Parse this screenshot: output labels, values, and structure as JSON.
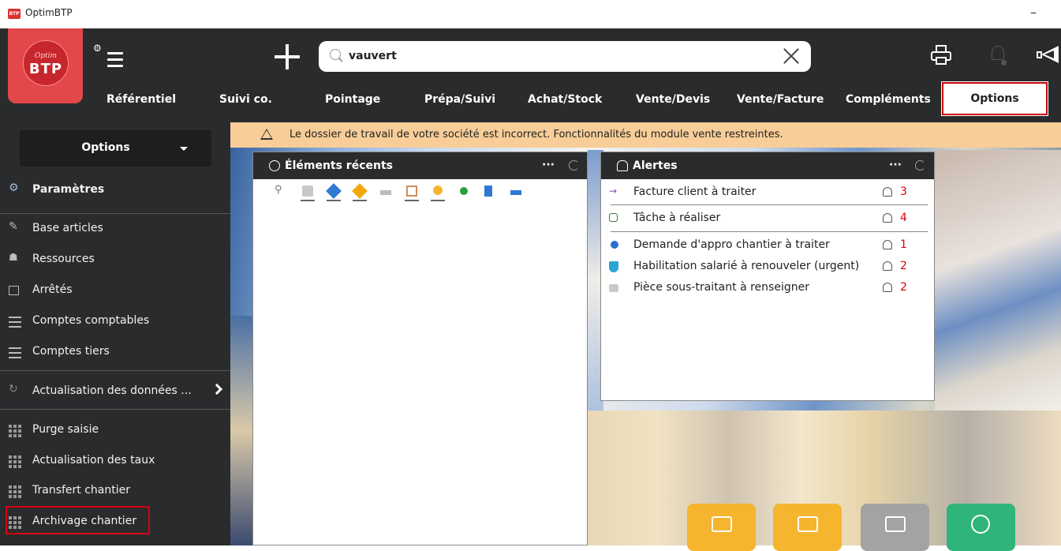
{
  "window": {
    "title": "OptimBTP",
    "minimize": "–"
  },
  "logo": {
    "top": "Optim",
    "bottom": "BTP"
  },
  "search": {
    "value": "vauvert",
    "placeholder": ""
  },
  "nav": {
    "items": [
      "Référentiel",
      "Suivi co.",
      "Pointage",
      "Prépa/Suivi",
      "Achat/Stock",
      "Vente/Devis",
      "Vente/Facture",
      "Compléments",
      "Options"
    ],
    "active": "Options"
  },
  "sidebar": {
    "dropdown": "Options",
    "items": [
      {
        "label": "Paramètres",
        "icon": "gears-icon"
      },
      {
        "label": "Base articles",
        "icon": "pencil-icon"
      },
      {
        "label": "Ressources",
        "icon": "users-icon"
      },
      {
        "label": "Arrêtés",
        "icon": "calendar-icon"
      },
      {
        "label": "Comptes comptables",
        "icon": "list-icon"
      },
      {
        "label": "Comptes tiers",
        "icon": "list-icon"
      },
      {
        "label": "Actualisation des données ...",
        "icon": "refresh-icon"
      },
      {
        "label": "Purge saisie",
        "icon": "grid-icon"
      },
      {
        "label": "Actualisation des taux",
        "icon": "grid-icon"
      },
      {
        "label": "Transfert chantier",
        "icon": "grid-icon"
      },
      {
        "label": "Archivage chantier",
        "icon": "grid-icon"
      }
    ]
  },
  "warning": {
    "text": "Le dossier de travail de votre société est incorrect. Fonctionnalités du module vente restreintes."
  },
  "recent": {
    "title": "Éléments récents",
    "more": "···"
  },
  "alerts": {
    "title": "Alertes",
    "more": "···",
    "rows": [
      {
        "text": "Facture client à traiter",
        "count": "3",
        "icon": "arrow-right-icon"
      },
      {
        "text": "Tâche à réaliser",
        "count": "4",
        "icon": "task-icon"
      },
      {
        "text": "Demande d'appro chantier à traiter",
        "count": "1",
        "icon": "blue-dot-icon"
      },
      {
        "text": "Habilitation salarié à renouveler (urgent)",
        "count": "2",
        "icon": "shield-icon"
      },
      {
        "text": "Pièce sous-traitant à renseigner",
        "count": "2",
        "icon": "houses-icon"
      }
    ]
  },
  "colors": {
    "header": "#2a2b2d",
    "accent": "#e2484a",
    "warning": "#f8cd98",
    "alert_count": "#d8000c"
  }
}
